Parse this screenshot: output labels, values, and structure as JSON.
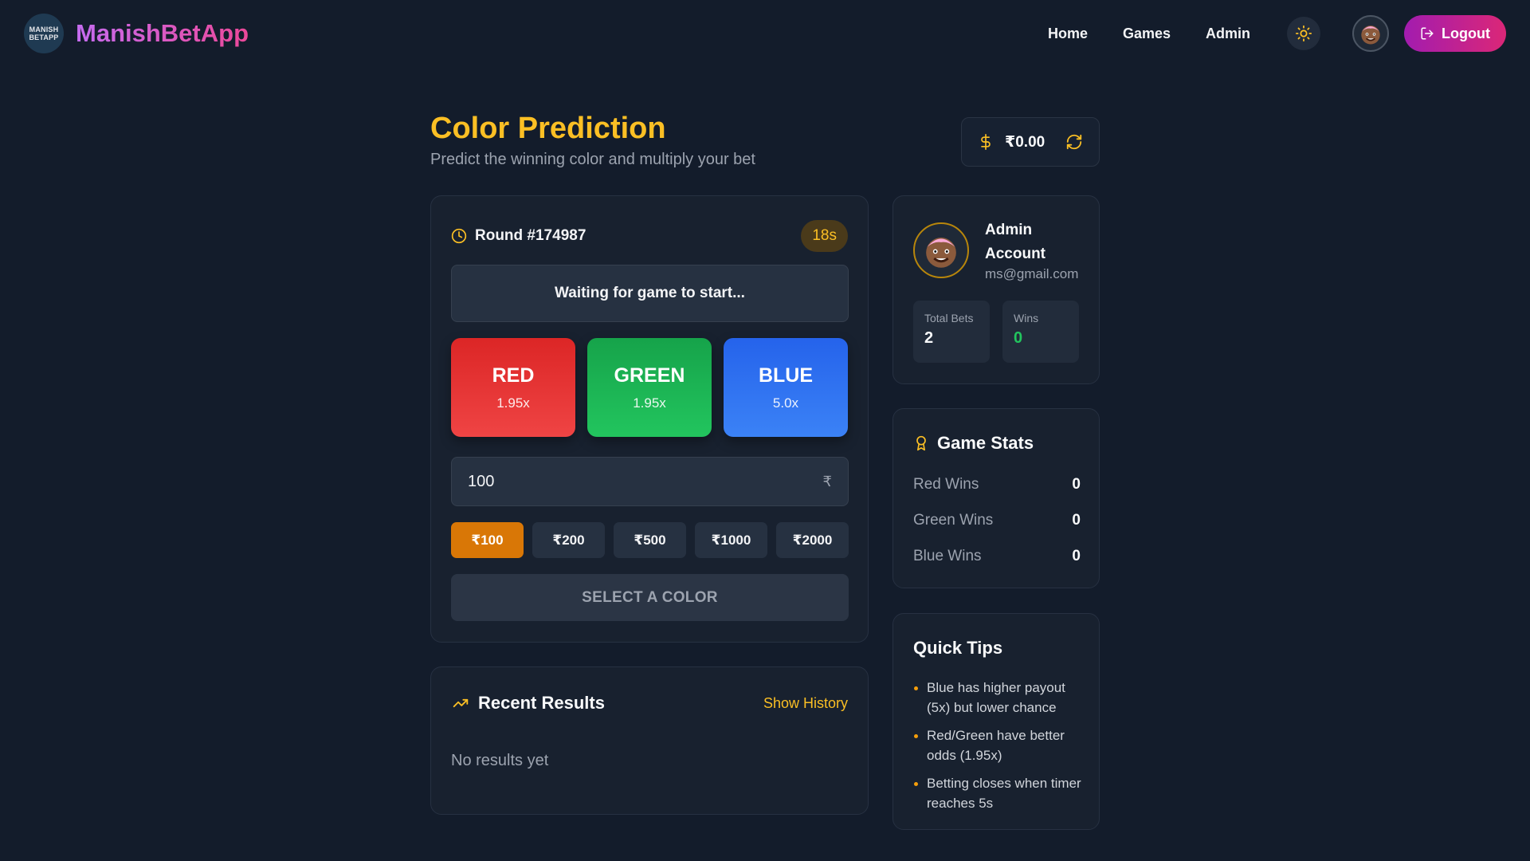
{
  "brand": {
    "logo_line1": "MANISH",
    "logo_line2": "BETAPP",
    "name": "ManishBetApp"
  },
  "nav": {
    "home": "Home",
    "games": "Games",
    "admin": "Admin",
    "logout": "Logout"
  },
  "page": {
    "title": "Color Prediction",
    "subtitle": "Predict the winning color and multiply your bet"
  },
  "balance": {
    "value": "₹0.00"
  },
  "game": {
    "round_label": "Round #174987",
    "timer": "18s",
    "status": "Waiting for game to start...",
    "colors": [
      {
        "name": "RED",
        "multiplier": "1.95x",
        "color": "#ef4444"
      },
      {
        "name": "GREEN",
        "multiplier": "1.95x",
        "color": "#22c55e"
      },
      {
        "name": "BLUE",
        "multiplier": "5.0x",
        "color": "#3b82f6"
      }
    ],
    "amount_value": "100",
    "amount_suffix": "₹",
    "quick_amounts": [
      "₹100",
      "₹200",
      "₹500",
      "₹1000",
      "₹2000"
    ],
    "selected_quick_amount": "₹100",
    "select_label": "SELECT A COLOR"
  },
  "results": {
    "title": "Recent Results",
    "show_history": "Show History",
    "empty": "No results yet"
  },
  "profile": {
    "name": "Admin Account",
    "email": "ms@gmail.com",
    "total_bets_label": "Total Bets",
    "total_bets": "2",
    "wins_label": "Wins",
    "wins": "0"
  },
  "stats": {
    "title": "Game Stats",
    "rows": [
      {
        "label": "Red Wins",
        "value": "0"
      },
      {
        "label": "Green Wins",
        "value": "0"
      },
      {
        "label": "Blue Wins",
        "value": "0"
      }
    ]
  },
  "tips": {
    "title": "Quick Tips",
    "items": [
      "Blue has higher payout (5x) but lower chance",
      "Red/Green have better odds (1.95x)",
      "Betting closes when timer reaches 5s"
    ]
  },
  "colors": {
    "accent": "#fbbf24",
    "bg": "#131c2b",
    "logout_gradient": [
      "#a21caf",
      "#db2777"
    ]
  },
  "icons": [
    "sun-icon",
    "dollar-icon",
    "refresh-icon",
    "clock-icon",
    "trending-up-icon",
    "award-icon",
    "logout-icon"
  ]
}
